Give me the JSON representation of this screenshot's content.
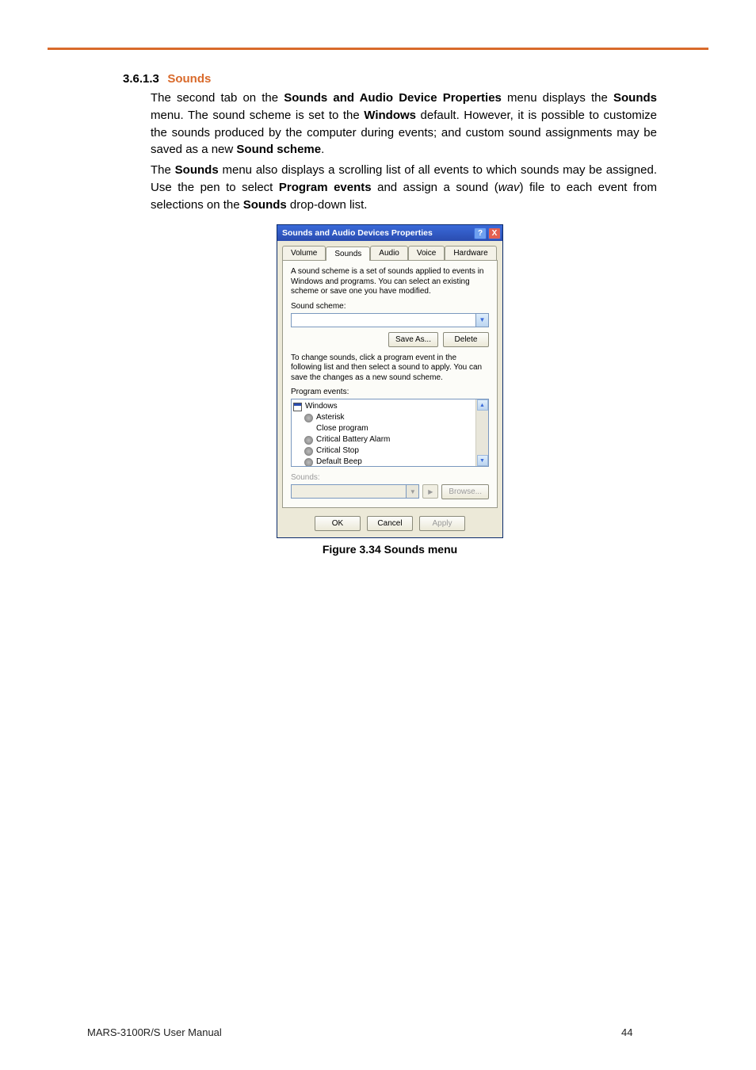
{
  "section": {
    "number": "3.6.1.3",
    "title": "Sounds"
  },
  "para1": {
    "t1": "The second tab on the ",
    "b1": "Sounds and Audio Device Properties",
    "t2": " menu displays the ",
    "b2": "Sounds",
    "t3": " menu. The sound scheme is set to the ",
    "b3": "Windows",
    "t4": " default. However, it is possible to customize the sounds produced by the computer during events; and custom sound assignments may be saved as a new ",
    "b4": "Sound scheme",
    "t5": "."
  },
  "para2": {
    "t1": "The ",
    "b1": "Sounds",
    "t2": " menu also displays a scrolling list of all events to which sounds may be assigned. Use the pen to select ",
    "b2": "Program events",
    "t3": " and assign a sound (",
    "i1": "wav",
    "t4": ") file to each event from selections on the ",
    "b3": "Sounds",
    "t5": " drop-down list."
  },
  "dialog": {
    "title": "Sounds and Audio Devices Properties",
    "help": "?",
    "close": "X",
    "tabs": {
      "volume": "Volume",
      "sounds": "Sounds",
      "audio": "Audio",
      "voice": "Voice",
      "hardware": "Hardware"
    },
    "scheme_desc": "A sound scheme is a set of sounds applied to events in Windows and programs. You can select an existing scheme or save one you have modified.",
    "scheme_label": "Sound scheme:",
    "save_as": "Save As...",
    "delete": "Delete",
    "change_desc": "To change sounds, click a program event in the following list and then select a sound to apply. You can save the changes as a new sound scheme.",
    "events_label": "Program events:",
    "events": {
      "root": "Windows",
      "items": [
        "Asterisk",
        "Close program",
        "Critical Battery Alarm",
        "Critical Stop",
        "Default Beep"
      ]
    },
    "sounds_label": "Sounds:",
    "browse": "Browse...",
    "ok": "OK",
    "cancel": "Cancel",
    "apply": "Apply"
  },
  "figure_caption": "Figure 3.34 Sounds menu",
  "footer": {
    "manual": "MARS-3100R/S User Manual",
    "page": "44"
  }
}
